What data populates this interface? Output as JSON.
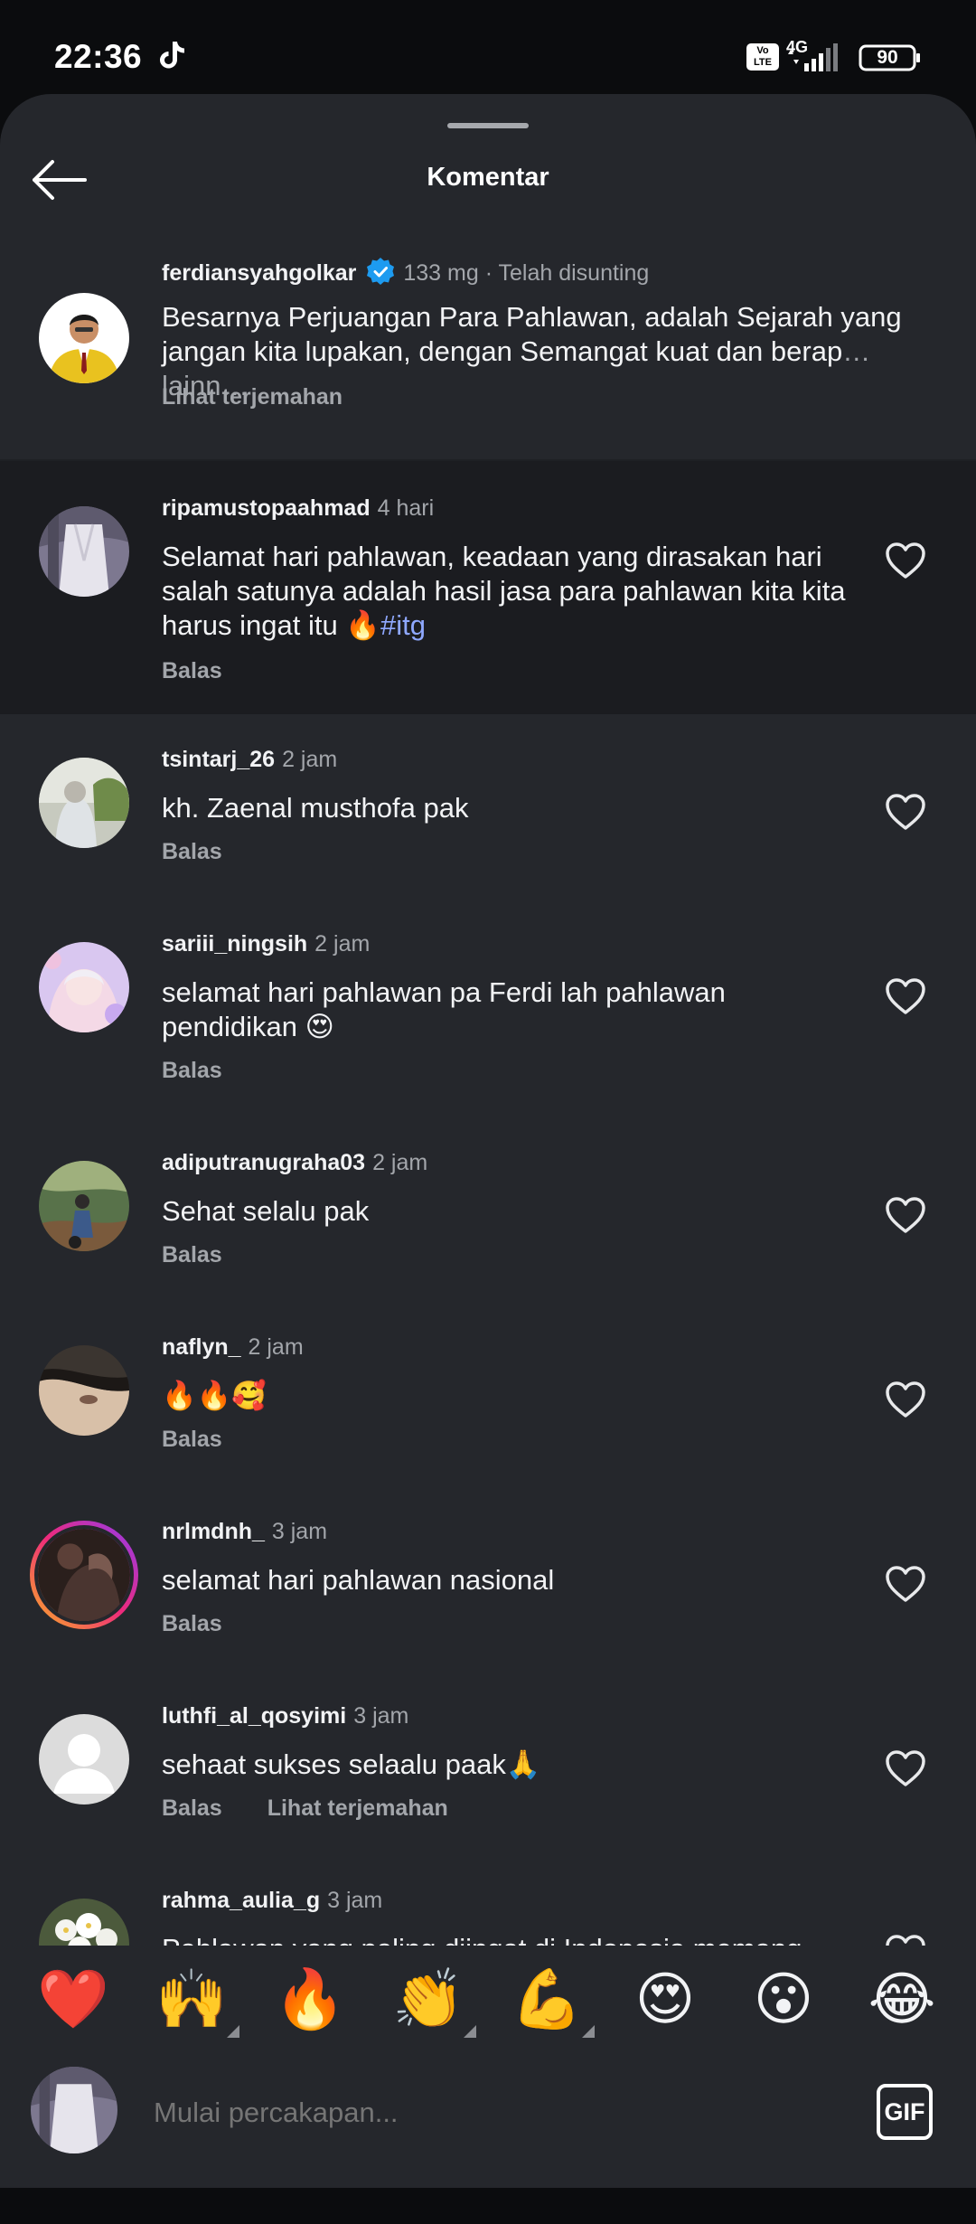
{
  "status": {
    "time": "22:36",
    "volte": "Vo LTE",
    "network": "4G",
    "battery": "90"
  },
  "header": {
    "title": "Komentar"
  },
  "caption": {
    "username": "ferdiansyahgolkar",
    "meta": "133 mg · Telah disunting",
    "text": "Besarnya Perjuangan Para Pahlawan, adalah Sejarah yang jangan kita lupakan, dengan Semangat kuat dan berap",
    "more": "… lainn…",
    "translate": "Lihat terjemahan"
  },
  "comments": [
    {
      "username": "ripamustopaahmad",
      "time": "4 hari",
      "text": "Selamat hari pahlawan, keadaan yang dirasakan hari salah satunya adalah hasil jasa para pahlawan kita kita harus ingat itu 🔥",
      "hashtag": "#itg",
      "reply": "Balas"
    },
    {
      "username": "tsintarj_26",
      "time": "2 jam",
      "text": "kh. Zaenal musthofa pak",
      "reply": "Balas"
    },
    {
      "username": "sariii_ningsih",
      "time": "2 jam",
      "text": "selamat hari pahlawan pa Ferdi lah pahlawan pendidikan 😍",
      "reply": "Balas"
    },
    {
      "username": "adiputranugraha03",
      "time": "2 jam",
      "text": "Sehat selalu pak",
      "reply": "Balas"
    },
    {
      "username": "naflyn_",
      "time": "2 jam",
      "text": "🔥🔥🥰",
      "reply": "Balas"
    },
    {
      "username": "nrlmdnh_",
      "time": "3 jam",
      "text": "selamat hari pahlawan nasional",
      "reply": "Balas"
    },
    {
      "username": "luthfi_al_qosyimi",
      "time": "3 jam",
      "text": "sehaat sukses selaalu paak🙏",
      "reply": "Balas",
      "translate": "Lihat terjemahan"
    },
    {
      "username": "rahma_aulia_g",
      "time": "3 jam",
      "text": "Pahlawan yang paling diingat di Indonesia memang"
    }
  ],
  "reactions": [
    "❤️",
    "🙌",
    "🔥",
    "👏",
    "💪",
    "😍",
    "😮",
    "😂"
  ],
  "composer": {
    "placeholder": "Mulai percakapan...",
    "gif_label": "GIF"
  },
  "colors": {
    "background": "#25272c",
    "highlight": "#1b1c20",
    "secondary_text": "#a3a6ab",
    "hashtag": "#8fa8ff",
    "verified": "#1d9bf0"
  }
}
